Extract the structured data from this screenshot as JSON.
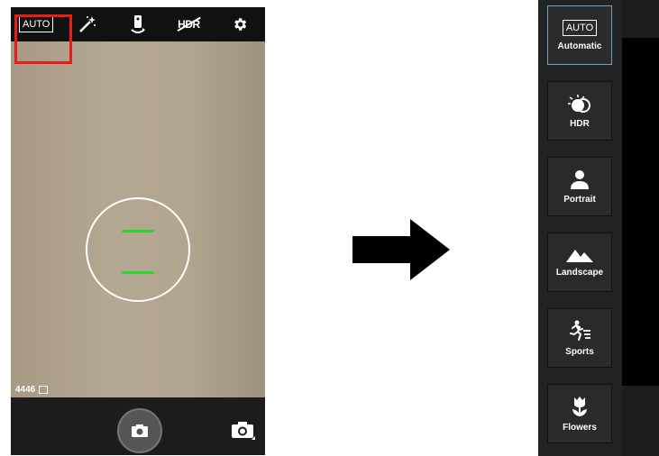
{
  "camera": {
    "top_icons": [
      "auto-icon",
      "magic-wand-icon",
      "panorama-icon",
      "hdr-off-icon",
      "gear-icon"
    ],
    "auto_label": "AUTO",
    "hdr_label": "HDR",
    "photo_count": "4446"
  },
  "modes": [
    {
      "label": "Automatic",
      "icon": "auto-icon",
      "icon_text": "AUTO",
      "selected": true
    },
    {
      "label": "HDR",
      "icon": "hdr-icon"
    },
    {
      "label": "Portrait",
      "icon": "portrait-icon"
    },
    {
      "label": "Landscape",
      "icon": "landscape-icon"
    },
    {
      "label": "Sports",
      "icon": "sports-icon"
    },
    {
      "label": "Flowers",
      "icon": "flowers-icon"
    }
  ],
  "colors": {
    "highlight": "#e41d1d",
    "focus": "#2bd62b",
    "selected_border": "#6aa3c8"
  }
}
